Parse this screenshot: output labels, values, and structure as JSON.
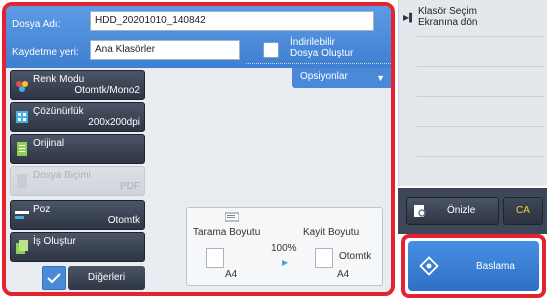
{
  "file": {
    "name_label": "Dosya Adı:",
    "name_value": "HDD_20201010_140842",
    "location_label": "Kaydetme yeri:",
    "location_value": "Ana Klasörler",
    "downloadable_label_line1": "İndirilebilir",
    "downloadable_label_line2": "Dosya Oluştur"
  },
  "options_tab": {
    "label": "Opsiyonlar"
  },
  "functions": [
    {
      "title": "Renk Modu",
      "value": "Otomtk/Mono2",
      "icon": "color-mode-icon",
      "enabled": true
    },
    {
      "title": "Çözünürlük",
      "value": "200x200dpi",
      "icon": "resolution-icon",
      "enabled": true
    },
    {
      "title": "Orijinal",
      "value": "",
      "icon": "original-icon",
      "enabled": true
    },
    {
      "title": "Dosya Biçimi",
      "value": "PDF",
      "icon": "file-format-icon",
      "enabled": false
    },
    {
      "title": "Poz",
      "value": "Otomtk",
      "icon": "exposure-icon",
      "enabled": true
    },
    {
      "title": "İş Oluştur",
      "value": "",
      "icon": "job-build-icon",
      "enabled": true
    }
  ],
  "others_button": {
    "label": "Diğerleri"
  },
  "preview": {
    "scan_size_label": "Tarama Boyutu",
    "scan_size_value": "A4",
    "ratio": "100%",
    "store_size_label": "Kayit Boyutu",
    "store_size_mode": "Otomtk",
    "store_size_value": "A4"
  },
  "right_panel": {
    "folder_select_line1": "Klasör Seçim",
    "folder_select_line2": "Ekranına dön"
  },
  "actions": {
    "preview_label": "Önizle",
    "clear_label": "CA",
    "start_label": "Baslama"
  },
  "colors": {
    "accent_blue": "#4a89d8",
    "highlight_red": "#e3232f",
    "dark_button": "#2e3644",
    "ca_text": "#f4d22a"
  }
}
